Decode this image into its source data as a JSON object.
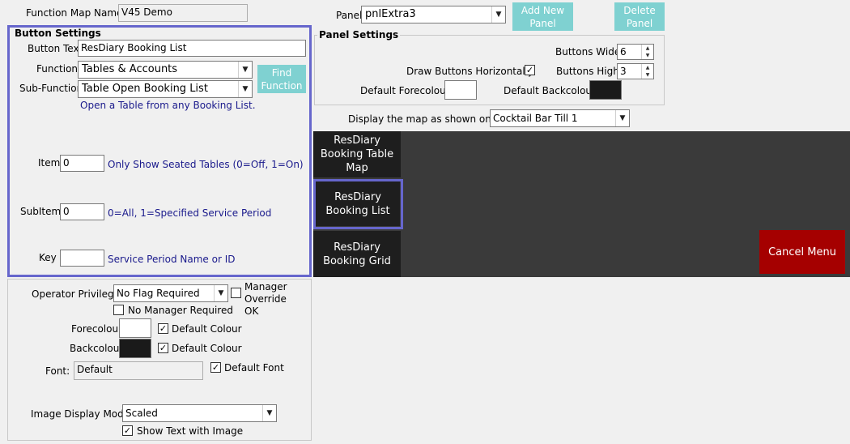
{
  "header": {
    "map_name_label": "Function Map Name:",
    "map_name_value": "V45 Demo",
    "panel_label": "Panel",
    "panel_value": "pnlExtra3",
    "add_panel_label": "Add New Panel",
    "delete_panel_label": "Delete Panel"
  },
  "button_settings": {
    "group_label": "Button Settings",
    "button_text_label": "Button Text",
    "button_text_value": "ResDiary Booking List",
    "function_label": "Function",
    "function_value": "Tables & Accounts",
    "find_function_label": "Find Function",
    "subfunction_label": "Sub-Function",
    "subfunction_value": "Table Open Booking List",
    "subfunction_desc": "Open a Table from any Booking List.",
    "item_label": "Item",
    "item_value": "0",
    "item_desc": "Only Show Seated Tables (0=Off, 1=On)",
    "subitem_label": "SubItem",
    "subitem_value": "0",
    "subitem_desc": "0=All, 1=Specified Service Period",
    "key_label": "Key",
    "key_value": "",
    "key_desc": "Service Period Name or ID"
  },
  "lower_settings": {
    "operator_priv_label": "Operator Privilege:",
    "operator_priv_value": "No Flag Required",
    "manager_override_label": "Manager Override OK",
    "no_manager_label": "No Manager Required",
    "forecolour_label": "Forecolour",
    "backcolour_label": "Backcolour",
    "default_colour_label": "Default Colour",
    "font_label": "Font:",
    "font_value": "Default",
    "default_font_label": "Default Font",
    "image_mode_label": "Image Display Mode:",
    "image_mode_value": "Scaled",
    "show_text_label": "Show Text with Image"
  },
  "panel_settings": {
    "group_label": "Panel Settings",
    "buttons_wide_label": "Buttons Wide:",
    "buttons_wide_value": "6",
    "draw_horizontal_label": "Draw Buttons Horizontally:",
    "buttons_high_label": "Buttons High:",
    "buttons_high_value": "3",
    "default_fore_label": "Default Forecolour",
    "default_back_label": "Default Backcolour",
    "display_map_label": "Display the map as shown on till:",
    "display_map_value": "Cocktail Bar Till 1"
  },
  "preview": {
    "tiles": [
      {
        "label": "ResDiary Booking Table Map"
      },
      {
        "label": "ResDiary Booking List"
      },
      {
        "label": "ResDiary Booking Grid"
      }
    ],
    "cancel_label": "Cancel Menu"
  },
  "colors": {
    "accent_teal": "#7fd1d1",
    "selection_outline": "#6666cc",
    "cancel_red": "#a50000",
    "preview_bg": "#3a3a3a",
    "tile_bg": "#1e1e1e"
  }
}
